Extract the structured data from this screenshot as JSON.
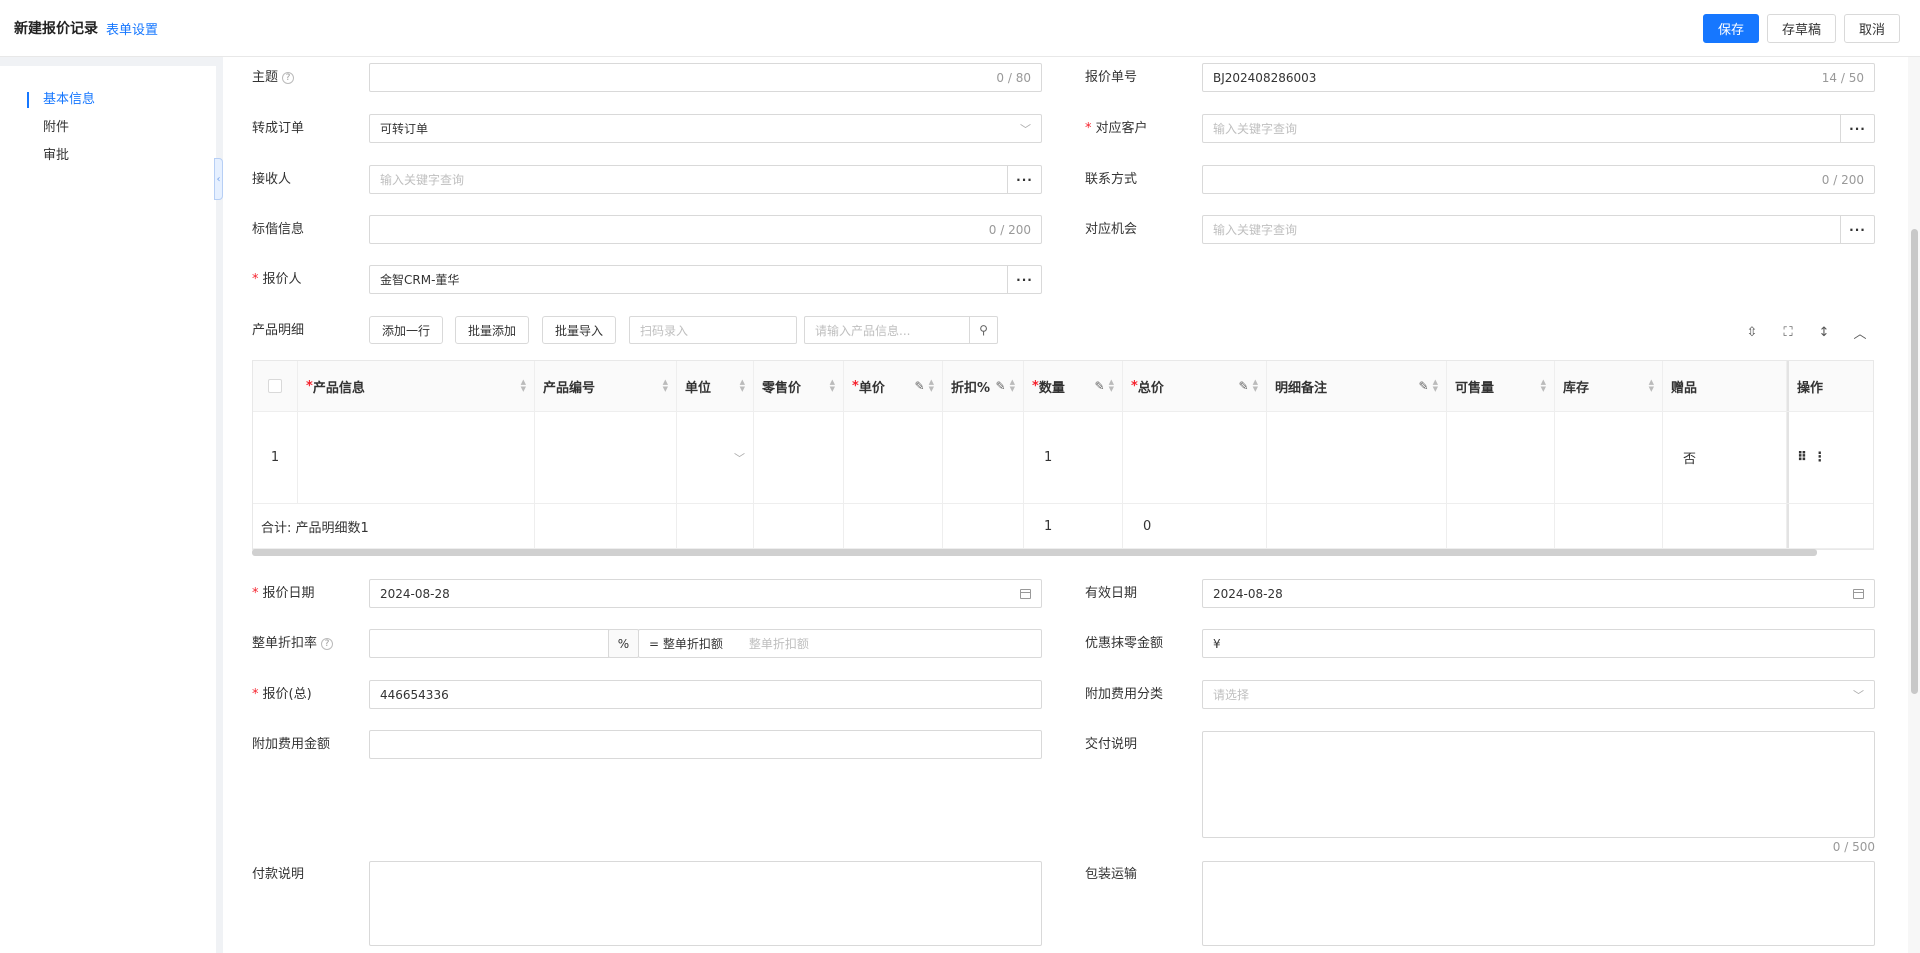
{
  "header": {
    "title": "新建报价记录",
    "form_settings": "表单设置",
    "save": "保存",
    "draft": "存草稿",
    "cancel": "取消"
  },
  "sidebar": {
    "items": [
      {
        "label": "基本信息"
      },
      {
        "label": "附件"
      },
      {
        "label": "审批"
      }
    ]
  },
  "form": {
    "subject": {
      "label": "主题",
      "value": "",
      "count": "0 / 80"
    },
    "quote_no": {
      "label": "报价单号",
      "value": "BJ202408286003",
      "count": "14 / 50"
    },
    "convert_order": {
      "label": "转成订单",
      "value": "可转订单"
    },
    "customer": {
      "label": "对应客户",
      "placeholder": "输入关键字查询"
    },
    "receiver": {
      "label": "接收人",
      "placeholder": "输入关键字查询"
    },
    "contact": {
      "label": "联系方式",
      "count": "0 / 200"
    },
    "bid_info": {
      "label": "标偕信息",
      "count": "0 / 200"
    },
    "opportunity": {
      "label": "对应机会",
      "placeholder": "输入关键字查询"
    },
    "quoter": {
      "label": "报价人",
      "value": "金智CRM-董华"
    },
    "product_detail": {
      "label": "产品明细",
      "add_row": "添加一行",
      "batch_add": "批量添加",
      "batch_import": "批量导入",
      "scan_placeholder": "扫码录入",
      "search_placeholder": "请输入产品信息..."
    },
    "quote_date": {
      "label": "报价日期",
      "value": "2024-08-28"
    },
    "valid_date": {
      "label": "有效日期",
      "value": "2024-08-28"
    },
    "discount_rate": {
      "label": "整单折扣率",
      "unit": "%",
      "eq_label": "= 整单折扣额",
      "amount_placeholder": "整单折扣额"
    },
    "rounding": {
      "label": "优惠抹零金额",
      "value": "¥"
    },
    "total": {
      "label": "报价(总)",
      "value": "446654336"
    },
    "extra_fee_type": {
      "label": "附加费用分类",
      "placeholder": "请选择"
    },
    "extra_fee_amount": {
      "label": "附加费用金额"
    },
    "delivery": {
      "label": "交付说明",
      "count": "0 / 500"
    },
    "payment": {
      "label": "付款说明"
    },
    "packing": {
      "label": "包装运输"
    }
  },
  "table": {
    "columns": [
      "产品信息",
      "产品编号",
      "单位",
      "零售价",
      "单价",
      "折扣%",
      "数量",
      "总价",
      "明细备注",
      "可售量",
      "库存",
      "赠品",
      "操作"
    ],
    "rows": [
      {
        "index": "1",
        "product": "",
        "code": "",
        "unit": "",
        "retail": "",
        "price": "",
        "discount": "",
        "qty": "1",
        "total": "",
        "note": "",
        "sellable": "",
        "stock": "",
        "gift": "否"
      }
    ],
    "footer": {
      "summary": "合计: 产品明细数1",
      "qty": "1",
      "total": "0"
    }
  }
}
